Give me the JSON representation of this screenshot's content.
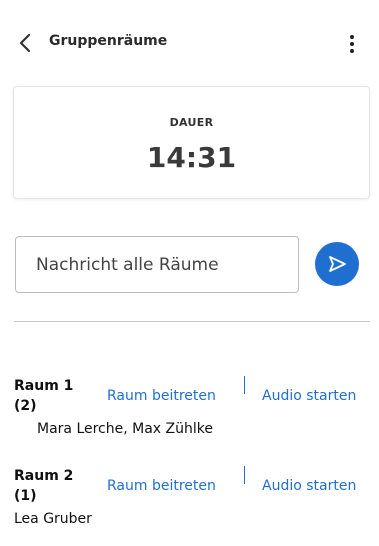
{
  "header": {
    "back_icon": "chevron-left-icon",
    "title": "Gruppenräume",
    "more_icon": "more-vertical-icon"
  },
  "timer": {
    "label": "DAUER",
    "value": "14:31"
  },
  "message": {
    "placeholder": "Nachricht alle Räume",
    "value": "",
    "send_icon": "send-icon"
  },
  "rooms": [
    {
      "name": "Raum 1 (2)",
      "join_label": "Raum beitreten",
      "audio_label": "Audio starten",
      "members": "Mara Lerche, Max Zühlke"
    },
    {
      "name": "Raum 2 (1)",
      "join_label": "Raum beitreten",
      "audio_label": "Audio starten",
      "members": "Lea Gruber"
    }
  ],
  "colors": {
    "accent": "#1f6fd1",
    "text": "#222222",
    "divider": "#c8c8c8"
  }
}
